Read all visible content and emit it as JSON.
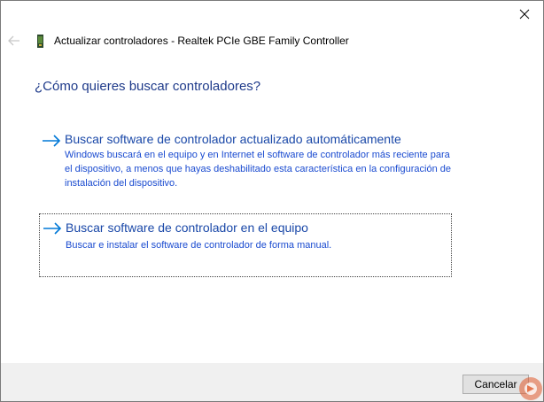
{
  "window": {
    "title": "Actualizar controladores - Realtek PCIe GBE Family Controller"
  },
  "icons": {
    "close": "close-icon",
    "back": "back-arrow-icon",
    "device": "network-adapter-icon",
    "option_arrow": "arrow-right-icon"
  },
  "main": {
    "question": "¿Cómo quieres buscar controladores?",
    "options": [
      {
        "title": "Buscar software de controlador actualizado automáticamente",
        "description": "Windows buscará en el equipo y en Internet el software de controlador más reciente para el dispositivo, a menos que hayas deshabilitado esta característica en la configuración de instalación del dispositivo."
      },
      {
        "title": "Buscar software de controlador en el equipo",
        "description": "Buscar e instalar el software de controlador de forma manual."
      }
    ]
  },
  "footer": {
    "cancel_label": "Cancelar"
  },
  "colors": {
    "link": "#1a48a8",
    "heading": "#1e3a8a",
    "footer_bg": "#f0f0f0",
    "accent_blue": "#0078d7"
  }
}
